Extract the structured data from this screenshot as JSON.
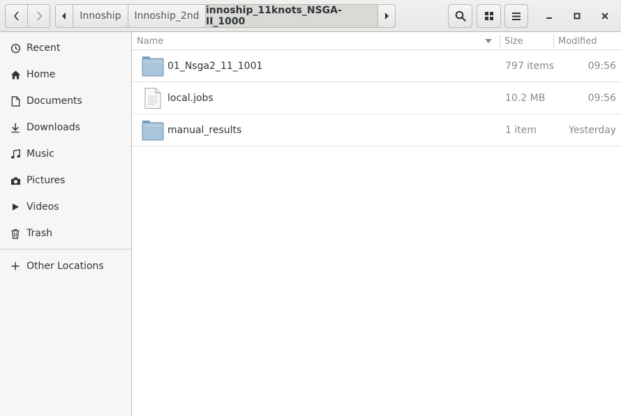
{
  "header": {
    "breadcrumbs": [
      "Innoship",
      "Innoship_2nd",
      "innoship_11knots_NSGA-II_1000"
    ]
  },
  "sidebar": {
    "items": [
      {
        "label": "Recent",
        "icon": "clock-icon"
      },
      {
        "label": "Home",
        "icon": "home-icon"
      },
      {
        "label": "Documents",
        "icon": "document-icon"
      },
      {
        "label": "Downloads",
        "icon": "download-icon"
      },
      {
        "label": "Music",
        "icon": "music-icon"
      },
      {
        "label": "Pictures",
        "icon": "camera-icon"
      },
      {
        "label": "Videos",
        "icon": "video-icon"
      },
      {
        "label": "Trash",
        "icon": "trash-icon"
      },
      {
        "label": "Other Locations",
        "icon": "plus-icon"
      }
    ]
  },
  "list": {
    "columns": {
      "name": "Name",
      "size": "Size",
      "modified": "Modified"
    },
    "rows": [
      {
        "name": "01_Nsga2_11_1001",
        "size": "797 items",
        "modified": "09:56",
        "type": "folder"
      },
      {
        "name": "local.jobs",
        "size": "10.2 MB",
        "modified": "09:56",
        "type": "text-file"
      },
      {
        "name": "manual_results",
        "size": "1 item",
        "modified": "Yesterday",
        "type": "folder"
      }
    ]
  },
  "colors": {
    "folder": "#a9c5dc",
    "folder_dark": "#7d9cb8",
    "accent_text": "#2e3436",
    "muted_text": "#888a85"
  }
}
